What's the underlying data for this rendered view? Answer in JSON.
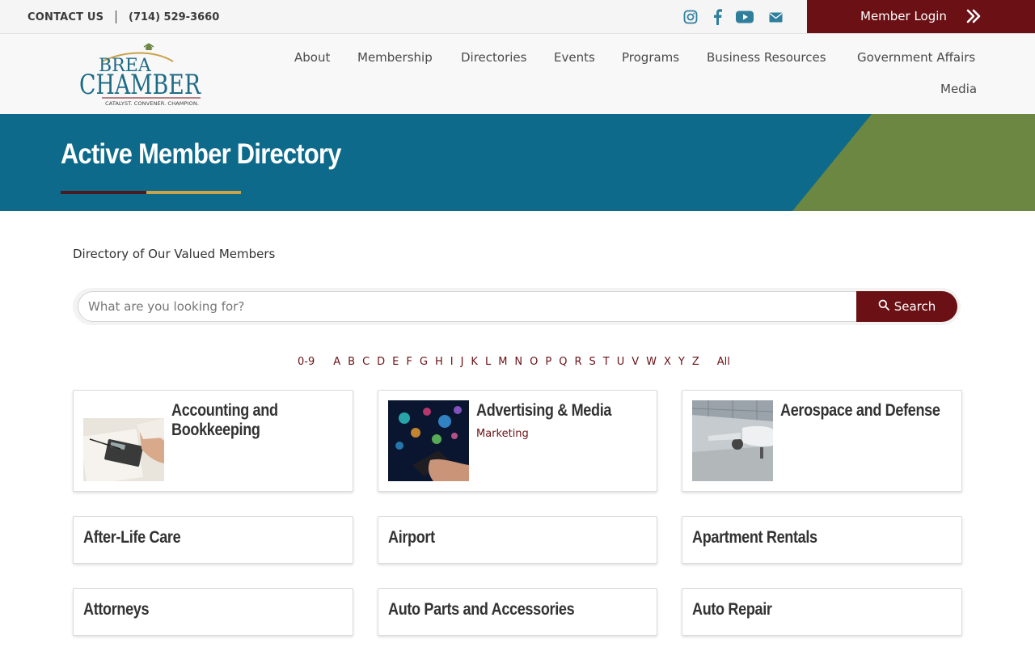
{
  "topbar": {
    "contact_label": "CONTACT US",
    "phone": "(714) 529-3660",
    "social_icons": [
      "instagram-icon",
      "facebook-icon",
      "youtube-icon",
      "email-icon"
    ],
    "social_color": "#2f7f9c",
    "member_login": "Member Login"
  },
  "logo": {
    "name_top": "BREA",
    "name_bottom": "CHAMBER",
    "tagline": "CATALYST. CONVENER. CHAMPION."
  },
  "nav": {
    "items": [
      "About",
      "Membership",
      "Directories",
      "Events",
      "Programs",
      "Business Resources",
      "Government Affairs",
      "Media"
    ]
  },
  "banner": {
    "title": "Active Member Directory",
    "colors": {
      "blue": "#0e6a8a",
      "green": "#6b8742",
      "dark": "#4a1a22",
      "gold": "#c9a24a"
    }
  },
  "directory": {
    "subtitle": "Directory of Our Valued Members",
    "search_placeholder": "What are you looking for?",
    "search_button": "Search",
    "alphabet": [
      "0-9",
      "A",
      "B",
      "C",
      "D",
      "E",
      "F",
      "G",
      "H",
      "I",
      "J",
      "K",
      "L",
      "M",
      "N",
      "O",
      "P",
      "Q",
      "R",
      "S",
      "T",
      "U",
      "V",
      "W",
      "X",
      "Y",
      "Z",
      "All"
    ],
    "categories": [
      {
        "title_lines": [
          "Accounting and",
          "Bookkeeping"
        ],
        "subcategory": ""
      },
      {
        "title_lines": [
          "Advertising & Media"
        ],
        "subcategory": "Marketing"
      },
      {
        "title_lines": [
          "Aerospace and Defense"
        ],
        "subcategory": ""
      },
      {
        "title_lines": [
          "After-Life Care"
        ],
        "subcategory": ""
      },
      {
        "title_lines": [
          "Airport"
        ],
        "subcategory": ""
      },
      {
        "title_lines": [
          "Apartment Rentals"
        ],
        "subcategory": ""
      },
      {
        "title_lines": [
          "Attorneys"
        ],
        "subcategory": ""
      },
      {
        "title_lines": [
          "Auto Parts and Accessories"
        ],
        "subcategory": ""
      },
      {
        "title_lines": [
          "Auto Repair"
        ],
        "subcategory": ""
      }
    ]
  },
  "accent_color": "#6b1115"
}
